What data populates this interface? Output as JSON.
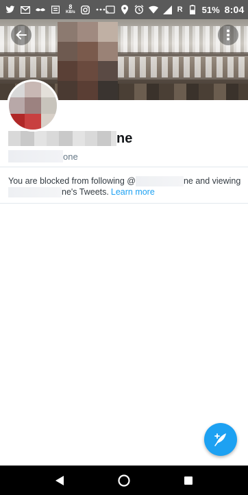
{
  "status_bar": {
    "left_icons": [
      "twitter-icon",
      "gmail-icon",
      "mustache-icon",
      "sd-card-icon"
    ],
    "network_speed_value": "8",
    "network_speed_unit": "KB/s",
    "more_icons": [
      "instagram-icon",
      "ellipsis-icon"
    ],
    "right_icons": [
      "cast-icon",
      "location-icon",
      "alarm-icon",
      "wifi-icon",
      "signal-icon"
    ],
    "roaming_label": "R",
    "battery_percent": "51%",
    "time": "8:04"
  },
  "header": {
    "back_icon": "arrow-left-icon",
    "more_icon": "vertical-dots-icon"
  },
  "profile": {
    "name_visible_suffix": "ne",
    "handle_visible_suffix": "one"
  },
  "blocked_notice": {
    "line1_prefix": "You are blocked from following @",
    "line1_suffix": "ne and viewing",
    "line2_suffix": "ne's Tweets.",
    "link_label": "Learn more"
  },
  "fab": {
    "icon": "compose-tweet-icon"
  },
  "nav_bar": {
    "back": "triangle-back-icon",
    "home": "circle-home-icon",
    "recents": "square-recents-icon"
  },
  "colors": {
    "accent": "#1da1f2",
    "status_bar": "#5a5a5a",
    "nav_bar": "#000000"
  }
}
